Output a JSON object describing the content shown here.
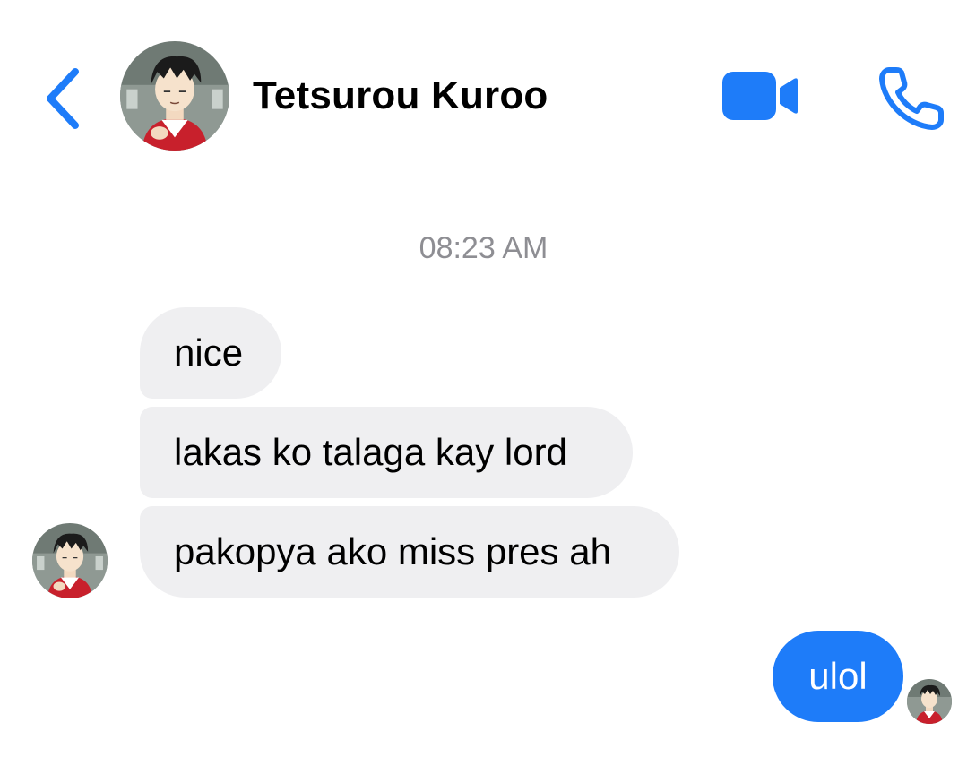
{
  "header": {
    "contact_name": "Tetsurou Kuroo",
    "back_icon": "chevron-left-icon",
    "video_icon": "video-camera-icon",
    "call_icon": "phone-icon",
    "accent_color": "#1e7cf9"
  },
  "conversation": {
    "timestamp": "08:23 AM",
    "incoming_messages": [
      {
        "text": "nice"
      },
      {
        "text": "lakas ko talaga kay lord"
      },
      {
        "text": "pakopya ako miss pres ah"
      }
    ],
    "outgoing_messages": [
      {
        "text": "ulol"
      }
    ],
    "incoming_bubble_color": "#efeff1",
    "outgoing_bubble_color": "#1e7cf9"
  }
}
